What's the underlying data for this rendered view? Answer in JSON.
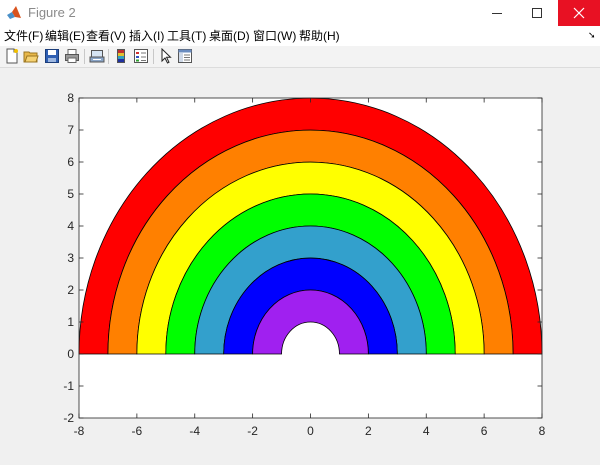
{
  "window": {
    "title": "Figure 2",
    "close_color": "#e81123"
  },
  "menubar": {
    "items": [
      "文件(F)",
      "编辑(E)",
      "查看(V)",
      "插入(I)",
      "工具(T)",
      "桌面(D)",
      "窗口(W)",
      "帮助(H)"
    ]
  },
  "toolbar": {
    "buttons": [
      {
        "name": "new-figure-icon"
      },
      {
        "name": "open-file-icon"
      },
      {
        "name": "save-icon"
      },
      {
        "name": "print-icon"
      },
      {
        "name": "link-plot-icon"
      },
      {
        "name": "insert-colorbar-icon"
      },
      {
        "name": "insert-legend-icon"
      },
      {
        "name": "edit-plot-arrow-icon"
      },
      {
        "name": "property-inspector-icon"
      }
    ]
  },
  "chart_data": {
    "type": "area",
    "title": "",
    "xlabel": "",
    "ylabel": "",
    "xlim": [
      -8,
      8
    ],
    "ylim": [
      -2,
      8
    ],
    "xticks": [
      -8,
      -6,
      -4,
      -2,
      0,
      2,
      4,
      6,
      8
    ],
    "yticks": [
      -2,
      -1,
      0,
      1,
      2,
      3,
      4,
      5,
      6,
      7,
      8
    ],
    "grid": false,
    "series": [
      {
        "inner_radius": 7,
        "outer_radius": 8,
        "color": "#ff0000"
      },
      {
        "inner_radius": 6,
        "outer_radius": 7,
        "color": "#ff8000"
      },
      {
        "inner_radius": 5,
        "outer_radius": 6,
        "color": "#ffff00"
      },
      {
        "inner_radius": 4,
        "outer_radius": 5,
        "color": "#00ff00"
      },
      {
        "inner_radius": 3,
        "outer_radius": 4,
        "color": "#33a0cc"
      },
      {
        "inner_radius": 2,
        "outer_radius": 3,
        "color": "#0000ff"
      },
      {
        "inner_radius": 1,
        "outer_radius": 2,
        "color": "#a020f0"
      }
    ]
  }
}
